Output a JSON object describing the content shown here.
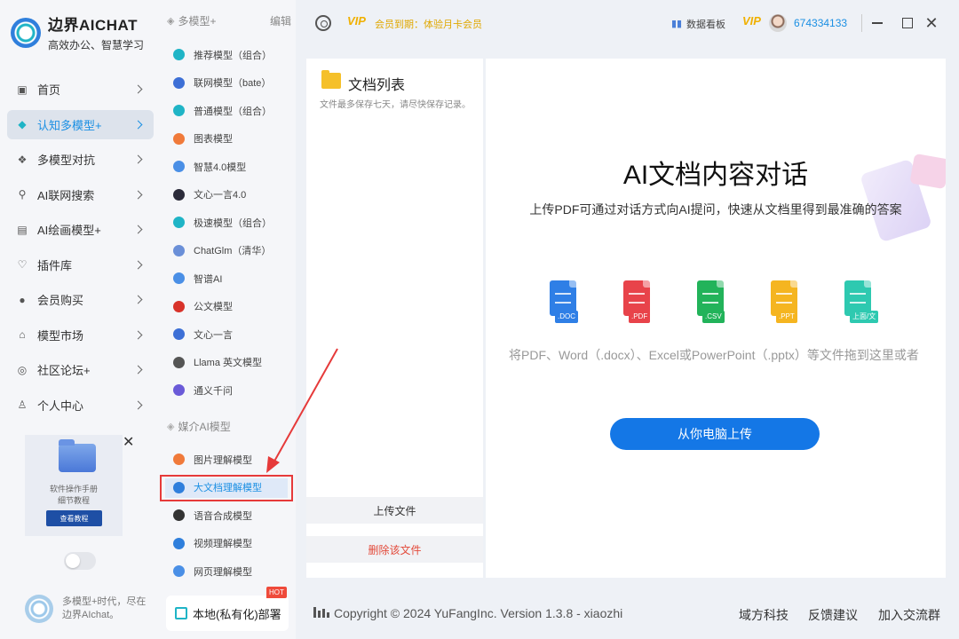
{
  "app": {
    "title": "边界AICHAT",
    "subtitle": "高效办公、智慧学习"
  },
  "nav": {
    "items": [
      {
        "label": "首页",
        "icon": "home-icon"
      },
      {
        "label": "认知多模型+",
        "icon": "cube-icon",
        "active": true
      },
      {
        "label": "多模型对抗",
        "icon": "versus-icon"
      },
      {
        "label": "AI联网搜索",
        "icon": "search-icon"
      },
      {
        "label": "AI绘画模型+",
        "icon": "image-icon"
      },
      {
        "label": "插件库",
        "icon": "bulb-icon"
      },
      {
        "label": "会员购买",
        "icon": "user-icon"
      },
      {
        "label": "模型市场",
        "icon": "market-icon"
      },
      {
        "label": "社区论坛+",
        "icon": "community-icon"
      },
      {
        "label": "个人中心",
        "icon": "profile-icon"
      }
    ]
  },
  "promo": {
    "line1": "软件操作手册",
    "line2": "细节教程",
    "button": "查看教程"
  },
  "bottom": {
    "text": "多模型+时代，尽在边界AIchat。"
  },
  "models": {
    "group1": "多模型+",
    "edit": "编辑",
    "list1": [
      {
        "label": "推荐模型（组合）",
        "color": "#1fb4c6"
      },
      {
        "label": "联网模型（bate）",
        "color": "#3d6fd6"
      },
      {
        "label": "普通模型（组合）",
        "color": "#1fb4c6"
      },
      {
        "label": "图表模型",
        "color": "#f07a3a"
      },
      {
        "label": "智慧4.0模型",
        "color": "#4a8fe6"
      },
      {
        "label": "文心一言4.0",
        "color": "#2b2b3a"
      },
      {
        "label": "极速模型（组合）",
        "color": "#1fb4c6"
      },
      {
        "label": "ChatGlm（清华）",
        "color": "#6a8fd8"
      },
      {
        "label": "智谱AI",
        "color": "#4a8fe6"
      },
      {
        "label": "公文模型",
        "color": "#d8322a"
      },
      {
        "label": "文心一言",
        "color": "#3d6fd6"
      },
      {
        "label": "Llama 英文模型",
        "color": "#555555"
      },
      {
        "label": "通义千问",
        "color": "#6a5ad8"
      }
    ],
    "group2": "媒介AI模型",
    "list2": [
      {
        "label": "图片理解模型",
        "color": "#f07a3a"
      },
      {
        "label": "大文档理解模型",
        "color": "#2f7fdc",
        "selected": true
      },
      {
        "label": "语音合成模型",
        "color": "#333333"
      },
      {
        "label": "视频理解模型",
        "color": "#2f7fdc"
      },
      {
        "label": "网页理解模型",
        "color": "#4a8fe6"
      }
    ],
    "deploy": "本地(私有化)部署",
    "hot": "HOT"
  },
  "topbar": {
    "vip": "VIP",
    "member": "会员到期：体验月卡会员",
    "dashboard": "数据看板",
    "user_id": "674334133"
  },
  "docs": {
    "title": "文档列表",
    "desc": "文件最多保存七天，请尽快保存记录。",
    "upload": "上传文件",
    "delete": "删除该文件"
  },
  "main": {
    "title": "AI文档内容对话",
    "subtitle": "上传PDF可通过对话方式向AI提问，快速从文档里得到最准确的答案",
    "file_types": [
      {
        "tag": ".DOC",
        "color": "#2f7fe6"
      },
      {
        "tag": ".PDF",
        "color": "#e8434a"
      },
      {
        "tag": ".CSV",
        "color": "#22b35a"
      },
      {
        "tag": ".PPT",
        "color": "#f5b520"
      },
      {
        "tag": "上面/文",
        "color": "#2ec9b0"
      }
    ],
    "drop_text": "将PDF、Word（.docx）、Excel或PowerPoint（.pptx）等文件拖到这里或者",
    "upload_button": "从你电脑上传"
  },
  "footer": {
    "copyright": "Copyright © 2024 YuFangInc. Version 1.3.8 - xiaozhi",
    "links": [
      "域方科技",
      "反馈建议",
      "加入交流群"
    ]
  }
}
